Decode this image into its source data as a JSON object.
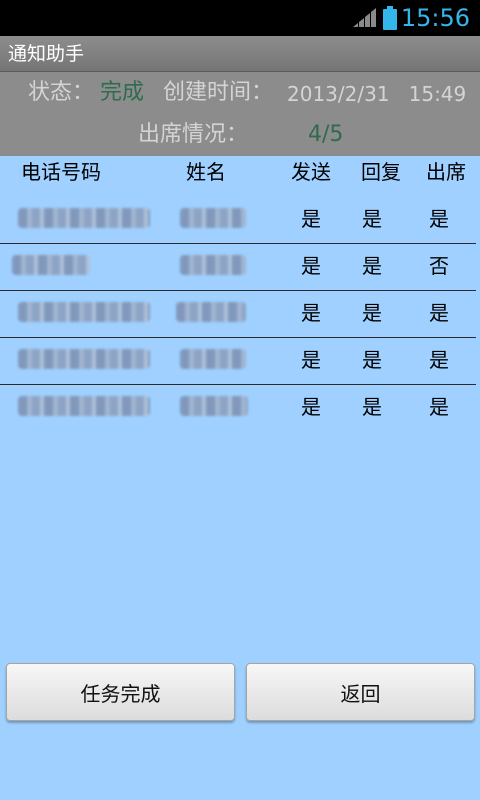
{
  "status_bar": {
    "clock": "15:56"
  },
  "app": {
    "title": "通知助手"
  },
  "summary": {
    "status_label": "状态：",
    "status_value": "完成",
    "created_label": "创建时间：",
    "created_value": "2013/2/31   15:49",
    "attendance_label": "出席情况：",
    "attendance_value": "4/5"
  },
  "table": {
    "columns": [
      "电话号码",
      "姓名",
      "发送",
      "回复",
      "出席"
    ],
    "rows": [
      {
        "send": "是",
        "reply": "是",
        "attend": "是"
      },
      {
        "send": "是",
        "reply": "是",
        "attend": "否"
      },
      {
        "send": "是",
        "reply": "是",
        "attend": "是"
      },
      {
        "send": "是",
        "reply": "是",
        "attend": "是"
      },
      {
        "send": "是",
        "reply": "是",
        "attend": "是"
      }
    ]
  },
  "buttons": {
    "complete": "任务完成",
    "back": "返回"
  },
  "icons": {
    "signal": "signal-icon",
    "battery": "battery-icon"
  },
  "colors": {
    "background": "#9fd0ff",
    "clock": "#35b6ea",
    "accent_value": "#2e6b4f"
  }
}
